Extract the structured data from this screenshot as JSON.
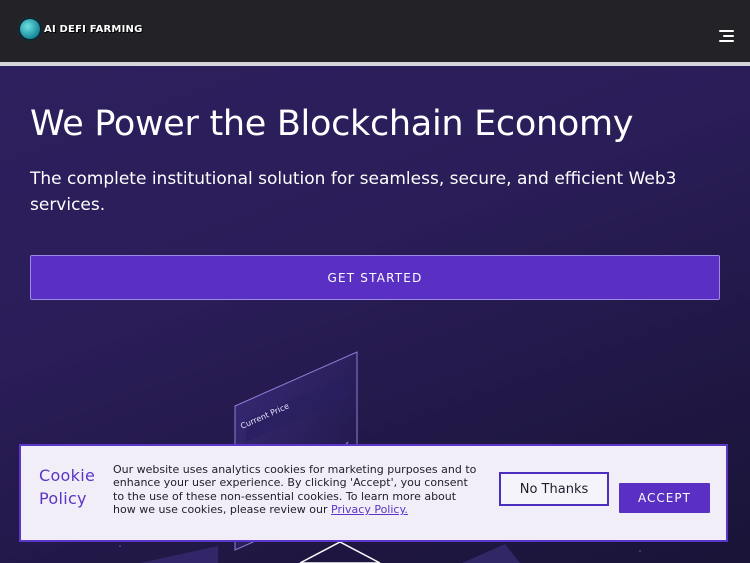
{
  "header": {
    "logo_text": "AI DEFI FARMING",
    "menu_icon": "hamburger-menu-icon"
  },
  "hero": {
    "title": "We Power the Blockchain Economy",
    "subtitle": "The complete institutional solution for seamless, secure, and efficient Web3 services.",
    "cta_label": "GET STARTED",
    "illustration": {
      "panel_title": "Current Price"
    }
  },
  "cookie_banner": {
    "title": "Cookie Policy",
    "text": "Our website uses analytics cookies for marketing purposes and to enhance your user experience. By clicking 'Accept', you consent to the use of these non-essential cookies. To learn more about how we use cookies, please review our ",
    "link_text": "Privacy Policy.",
    "no_thanks_label": "No Thanks",
    "accept_label": "ACCEPT"
  },
  "colors": {
    "accent": "#5a2fc4",
    "header_bg": "#232226",
    "hero_bg": "#2a1d58",
    "banner_bg": "#f1eef7"
  }
}
